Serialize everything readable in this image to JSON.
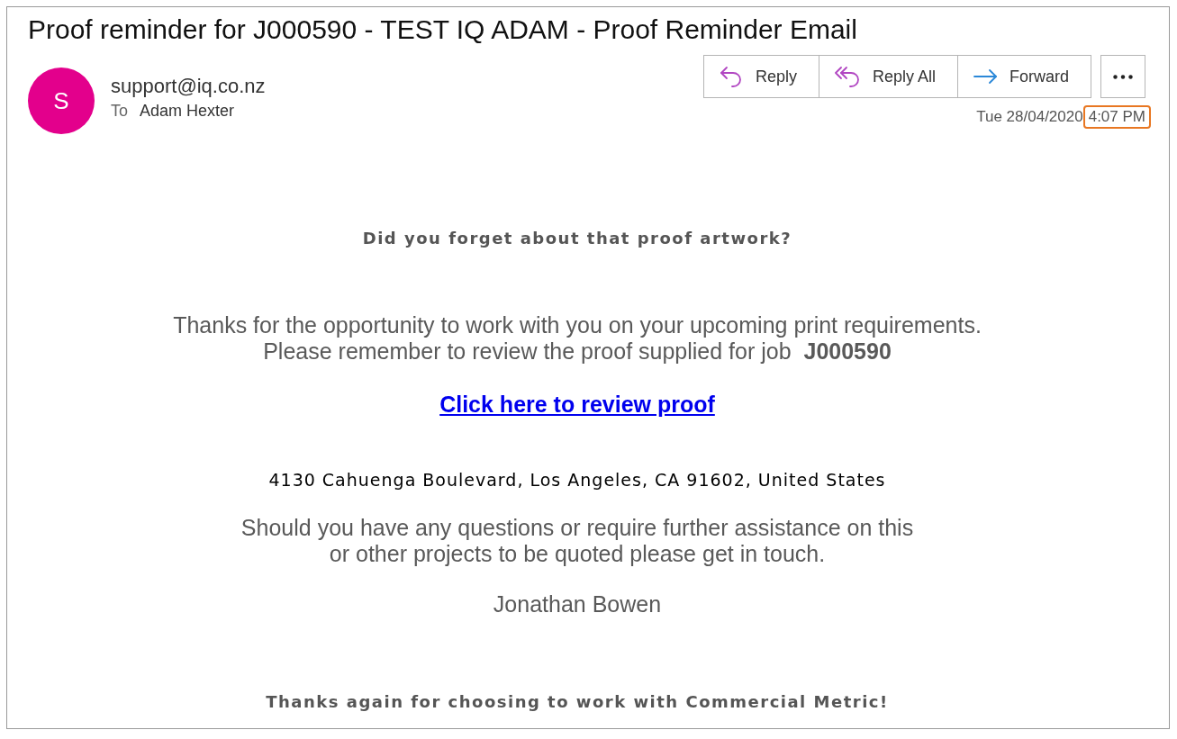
{
  "subject": "Proof reminder for J000590 - TEST IQ ADAM - Proof Reminder Email",
  "sender": {
    "initial": "S",
    "address": "support@iq.co.nz"
  },
  "recipient": {
    "label": "To",
    "name": "Adam Hexter"
  },
  "actions": [
    {
      "kind": "reply",
      "label": "Reply"
    },
    {
      "kind": "reply_all",
      "label": "Reply All"
    },
    {
      "kind": "forward",
      "label": "Forward"
    }
  ],
  "more_button": {
    "kind": "more"
  },
  "received": {
    "date": "Tue 28/04/2020",
    "time": "4:07 PM",
    "time_highlighted": true
  },
  "body": {
    "heading": "Did you forget about that proof artwork?",
    "intro": [
      "Thanks for the opportunity to work with you on your upcoming print requirements.",
      "Please remember to review the proof supplied for job  **J000590**"
    ],
    "link": "Click here to review proof",
    "address": "4130 Cahuenga Boulevard, Los Angeles, CA 91602, United States",
    "closing": [
      "Should you have any questions or require further assistance on this",
      "or other projects to be quoted please get in touch."
    ],
    "signature": "Jonathan Bowen",
    "footer": "Thanks again for choosing to work with Commercial Metric!"
  }
}
